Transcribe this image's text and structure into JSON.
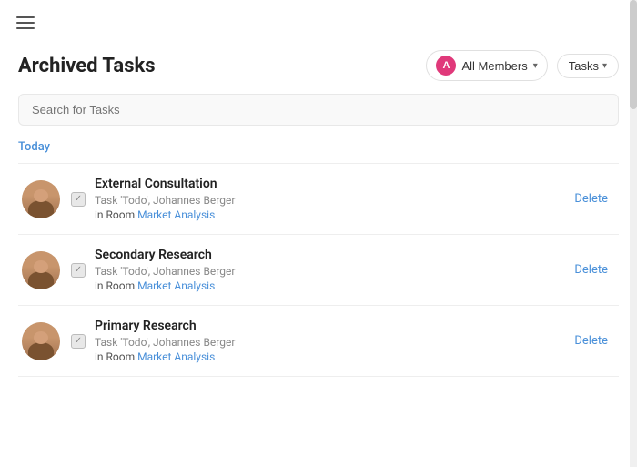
{
  "app": {
    "title": "Archived Tasks"
  },
  "header": {
    "members_label": "All Members",
    "members_avatar": "A",
    "tasks_label": "Tasks"
  },
  "search": {
    "placeholder": "Search for Tasks"
  },
  "section": {
    "today_label": "Today"
  },
  "tasks": [
    {
      "name": "External Consultation",
      "meta": "Task 'Todo', Johannes Berger",
      "room_prefix": "in Room ",
      "room_link": "Market Analysis",
      "delete_label": "Delete"
    },
    {
      "name": "Secondary Research",
      "meta": "Task 'Todo', Johannes Berger",
      "room_prefix": "in Room ",
      "room_link": "Market Analysis",
      "delete_label": "Delete"
    },
    {
      "name": "Primary Research",
      "meta": "Task 'Todo', Johannes Berger",
      "room_prefix": "in Room ",
      "room_link": "Market Analysis",
      "delete_label": "Delete"
    }
  ],
  "icons": {
    "hamburger": "☰",
    "chevron_down": "▾"
  }
}
